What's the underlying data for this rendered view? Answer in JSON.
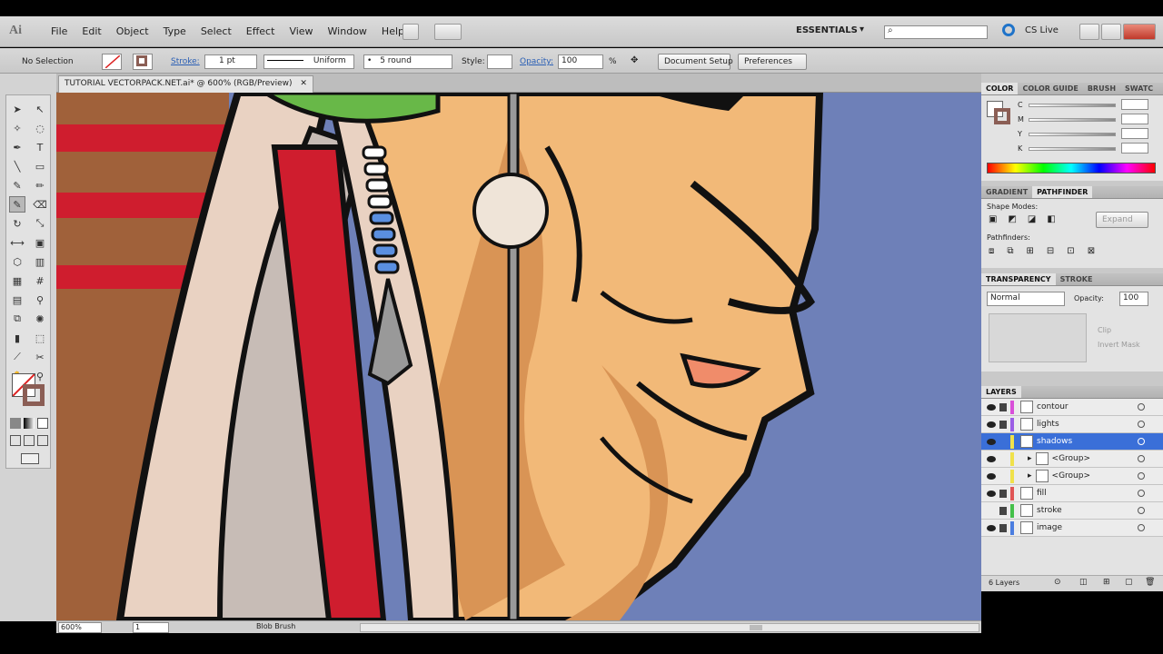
{
  "app": {
    "logo": "Ai"
  },
  "menu": [
    "File",
    "Edit",
    "Object",
    "Type",
    "Select",
    "Effect",
    "View",
    "Window",
    "Help"
  ],
  "workspace": {
    "label": "ESSENTIALS",
    "search_placeholder": "",
    "cslive": "CS Live"
  },
  "control": {
    "selection": "No Selection",
    "stroke_label": "Stroke:",
    "stroke_weight": "1 pt",
    "profile": "Uniform",
    "brush": "5 round",
    "style_label": "Style:",
    "opacity_label": "Opacity:",
    "opacity_value": "100",
    "percent": "%",
    "document_setup": "Document Setup",
    "preferences": "Preferences"
  },
  "document": {
    "tab": "TUTORIAL VECTORPACK.NET.ai* @ 600% (RGB/Preview)"
  },
  "status": {
    "zoom": "600%",
    "page": "1",
    "tool": "Blob Brush"
  },
  "color_panel": {
    "tabs": [
      "COLOR",
      "COLOR GUIDE",
      "BRUSH",
      "SWATC"
    ],
    "channels": [
      "C",
      "M",
      "Y",
      "K"
    ]
  },
  "pathfinder_panel": {
    "tabs": [
      "GRADIENT",
      "PATHFINDER"
    ],
    "shape_modes": "Shape Modes:",
    "pathfinders": "Pathfinders:",
    "expand": "Expand"
  },
  "transparency_panel": {
    "tabs": [
      "TRANSPARENCY",
      "STROKE"
    ],
    "mode": "Normal",
    "opacity_label": "Opacity:",
    "opacity_value": "100",
    "clip": "Clip",
    "invert_mask": "Invert Mask"
  },
  "layers_panel": {
    "title": "LAYERS",
    "layers": [
      {
        "name": "contour",
        "color": "#d94fd9"
      },
      {
        "name": "lights",
        "color": "#9b5de5"
      },
      {
        "name": "shadows",
        "color": "#f0e14a",
        "selected": true
      },
      {
        "name": "<Group>",
        "color": "#f0e14a"
      },
      {
        "name": "<Group>",
        "color": "#f0e14a"
      },
      {
        "name": "fill",
        "color": "#e05555"
      },
      {
        "name": "stroke",
        "color": "#44c04a"
      },
      {
        "name": "image",
        "color": "#4a7de0"
      }
    ],
    "count": "6 Layers"
  },
  "colors": {
    "canvas_bg": "#6e80b8",
    "selection": "#3a6fd8"
  }
}
